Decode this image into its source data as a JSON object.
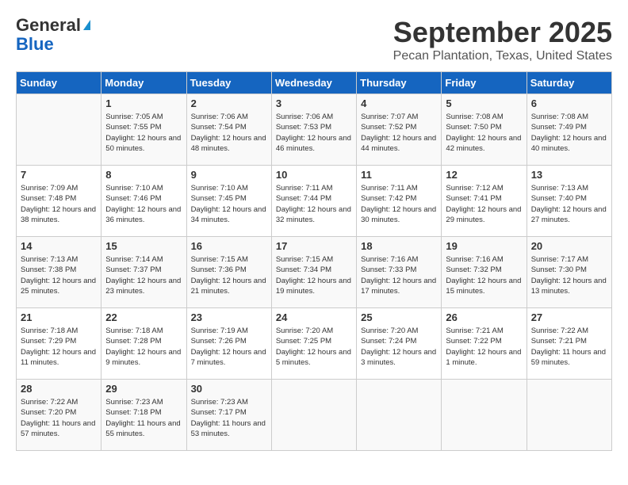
{
  "header": {
    "logo_line1": "General",
    "logo_line2": "Blue",
    "title": "September 2025",
    "subtitle": "Pecan Plantation, Texas, United States"
  },
  "calendar": {
    "days_of_week": [
      "Sunday",
      "Monday",
      "Tuesday",
      "Wednesday",
      "Thursday",
      "Friday",
      "Saturday"
    ],
    "weeks": [
      [
        {
          "day": "",
          "sunrise": "",
          "sunset": "",
          "daylight": ""
        },
        {
          "day": "1",
          "sunrise": "Sunrise: 7:05 AM",
          "sunset": "Sunset: 7:55 PM",
          "daylight": "Daylight: 12 hours and 50 minutes."
        },
        {
          "day": "2",
          "sunrise": "Sunrise: 7:06 AM",
          "sunset": "Sunset: 7:54 PM",
          "daylight": "Daylight: 12 hours and 48 minutes."
        },
        {
          "day": "3",
          "sunrise": "Sunrise: 7:06 AM",
          "sunset": "Sunset: 7:53 PM",
          "daylight": "Daylight: 12 hours and 46 minutes."
        },
        {
          "day": "4",
          "sunrise": "Sunrise: 7:07 AM",
          "sunset": "Sunset: 7:52 PM",
          "daylight": "Daylight: 12 hours and 44 minutes."
        },
        {
          "day": "5",
          "sunrise": "Sunrise: 7:08 AM",
          "sunset": "Sunset: 7:50 PM",
          "daylight": "Daylight: 12 hours and 42 minutes."
        },
        {
          "day": "6",
          "sunrise": "Sunrise: 7:08 AM",
          "sunset": "Sunset: 7:49 PM",
          "daylight": "Daylight: 12 hours and 40 minutes."
        }
      ],
      [
        {
          "day": "7",
          "sunrise": "Sunrise: 7:09 AM",
          "sunset": "Sunset: 7:48 PM",
          "daylight": "Daylight: 12 hours and 38 minutes."
        },
        {
          "day": "8",
          "sunrise": "Sunrise: 7:10 AM",
          "sunset": "Sunset: 7:46 PM",
          "daylight": "Daylight: 12 hours and 36 minutes."
        },
        {
          "day": "9",
          "sunrise": "Sunrise: 7:10 AM",
          "sunset": "Sunset: 7:45 PM",
          "daylight": "Daylight: 12 hours and 34 minutes."
        },
        {
          "day": "10",
          "sunrise": "Sunrise: 7:11 AM",
          "sunset": "Sunset: 7:44 PM",
          "daylight": "Daylight: 12 hours and 32 minutes."
        },
        {
          "day": "11",
          "sunrise": "Sunrise: 7:11 AM",
          "sunset": "Sunset: 7:42 PM",
          "daylight": "Daylight: 12 hours and 30 minutes."
        },
        {
          "day": "12",
          "sunrise": "Sunrise: 7:12 AM",
          "sunset": "Sunset: 7:41 PM",
          "daylight": "Daylight: 12 hours and 29 minutes."
        },
        {
          "day": "13",
          "sunrise": "Sunrise: 7:13 AM",
          "sunset": "Sunset: 7:40 PM",
          "daylight": "Daylight: 12 hours and 27 minutes."
        }
      ],
      [
        {
          "day": "14",
          "sunrise": "Sunrise: 7:13 AM",
          "sunset": "Sunset: 7:38 PM",
          "daylight": "Daylight: 12 hours and 25 minutes."
        },
        {
          "day": "15",
          "sunrise": "Sunrise: 7:14 AM",
          "sunset": "Sunset: 7:37 PM",
          "daylight": "Daylight: 12 hours and 23 minutes."
        },
        {
          "day": "16",
          "sunrise": "Sunrise: 7:15 AM",
          "sunset": "Sunset: 7:36 PM",
          "daylight": "Daylight: 12 hours and 21 minutes."
        },
        {
          "day": "17",
          "sunrise": "Sunrise: 7:15 AM",
          "sunset": "Sunset: 7:34 PM",
          "daylight": "Daylight: 12 hours and 19 minutes."
        },
        {
          "day": "18",
          "sunrise": "Sunrise: 7:16 AM",
          "sunset": "Sunset: 7:33 PM",
          "daylight": "Daylight: 12 hours and 17 minutes."
        },
        {
          "day": "19",
          "sunrise": "Sunrise: 7:16 AM",
          "sunset": "Sunset: 7:32 PM",
          "daylight": "Daylight: 12 hours and 15 minutes."
        },
        {
          "day": "20",
          "sunrise": "Sunrise: 7:17 AM",
          "sunset": "Sunset: 7:30 PM",
          "daylight": "Daylight: 12 hours and 13 minutes."
        }
      ],
      [
        {
          "day": "21",
          "sunrise": "Sunrise: 7:18 AM",
          "sunset": "Sunset: 7:29 PM",
          "daylight": "Daylight: 12 hours and 11 minutes."
        },
        {
          "day": "22",
          "sunrise": "Sunrise: 7:18 AM",
          "sunset": "Sunset: 7:28 PM",
          "daylight": "Daylight: 12 hours and 9 minutes."
        },
        {
          "day": "23",
          "sunrise": "Sunrise: 7:19 AM",
          "sunset": "Sunset: 7:26 PM",
          "daylight": "Daylight: 12 hours and 7 minutes."
        },
        {
          "day": "24",
          "sunrise": "Sunrise: 7:20 AM",
          "sunset": "Sunset: 7:25 PM",
          "daylight": "Daylight: 12 hours and 5 minutes."
        },
        {
          "day": "25",
          "sunrise": "Sunrise: 7:20 AM",
          "sunset": "Sunset: 7:24 PM",
          "daylight": "Daylight: 12 hours and 3 minutes."
        },
        {
          "day": "26",
          "sunrise": "Sunrise: 7:21 AM",
          "sunset": "Sunset: 7:22 PM",
          "daylight": "Daylight: 12 hours and 1 minute."
        },
        {
          "day": "27",
          "sunrise": "Sunrise: 7:22 AM",
          "sunset": "Sunset: 7:21 PM",
          "daylight": "Daylight: 11 hours and 59 minutes."
        }
      ],
      [
        {
          "day": "28",
          "sunrise": "Sunrise: 7:22 AM",
          "sunset": "Sunset: 7:20 PM",
          "daylight": "Daylight: 11 hours and 57 minutes."
        },
        {
          "day": "29",
          "sunrise": "Sunrise: 7:23 AM",
          "sunset": "Sunset: 7:18 PM",
          "daylight": "Daylight: 11 hours and 55 minutes."
        },
        {
          "day": "30",
          "sunrise": "Sunrise: 7:23 AM",
          "sunset": "Sunset: 7:17 PM",
          "daylight": "Daylight: 11 hours and 53 minutes."
        },
        {
          "day": "",
          "sunrise": "",
          "sunset": "",
          "daylight": ""
        },
        {
          "day": "",
          "sunrise": "",
          "sunset": "",
          "daylight": ""
        },
        {
          "day": "",
          "sunrise": "",
          "sunset": "",
          "daylight": ""
        },
        {
          "day": "",
          "sunrise": "",
          "sunset": "",
          "daylight": ""
        }
      ]
    ]
  }
}
